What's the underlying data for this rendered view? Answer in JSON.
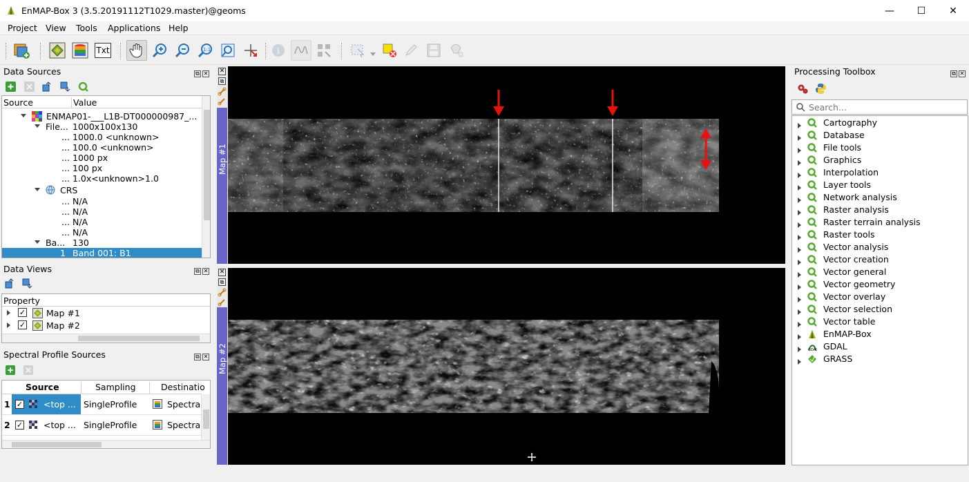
{
  "window": {
    "title": "EnMAP-Box 3 (3.5.20191112T1029.master)@geoms",
    "minimize": "—",
    "maximize": "☐",
    "close": "✕"
  },
  "menu": [
    "Project",
    "View",
    "Tools",
    "Applications",
    "Help"
  ],
  "toolbar": {
    "text_button": "Txt"
  },
  "data_sources": {
    "title": "Data Sources",
    "columns": [
      "Source",
      "Value"
    ],
    "rows": [
      {
        "source": "ENMAP01-___L1B-DT000000987_...",
        "value": ""
      },
      {
        "source": "File...",
        "value": "1000x100x130"
      },
      {
        "source": "...",
        "value": "1000.0 <unknown>"
      },
      {
        "source": "...",
        "value": "100.0 <unknown>"
      },
      {
        "source": "...",
        "value": "1000 px"
      },
      {
        "source": "...",
        "value": "100 px"
      },
      {
        "source": "...",
        "value": "1.0x<unknown>1.0"
      },
      {
        "source": "CRS",
        "value": ""
      },
      {
        "source": "...",
        "value": "N/A"
      },
      {
        "source": "...",
        "value": "N/A"
      },
      {
        "source": "...",
        "value": "N/A"
      },
      {
        "source": "...",
        "value": "N/A"
      },
      {
        "source": "Ba...",
        "value": "130"
      },
      {
        "source": "1",
        "value": "Band 001: B1"
      }
    ]
  },
  "data_views": {
    "title": "Data Views",
    "column": "Property",
    "items": [
      "Map #1",
      "Map #2"
    ]
  },
  "spectral": {
    "title": "Spectral Profile Sources",
    "columns": [
      "Source",
      "Sampling",
      "Destinatio"
    ],
    "rows": [
      {
        "num": "1",
        "source": "<top ...",
        "sampling": "SingleProfile",
        "destination": "Spectra"
      },
      {
        "num": "2",
        "source": "<top ...",
        "sampling": "SingleProfile",
        "destination": "Spectra"
      }
    ]
  },
  "maps": {
    "map1": "Map #1",
    "map2": "Map #2"
  },
  "processing": {
    "title": "Processing Toolbox",
    "search_placeholder": "Search...",
    "items": [
      {
        "label": "Cartography",
        "icon": "qgis-icon"
      },
      {
        "label": "Database",
        "icon": "qgis-icon"
      },
      {
        "label": "File tools",
        "icon": "qgis-icon"
      },
      {
        "label": "Graphics",
        "icon": "qgis-icon"
      },
      {
        "label": "Interpolation",
        "icon": "qgis-icon"
      },
      {
        "label": "Layer tools",
        "icon": "qgis-icon"
      },
      {
        "label": "Network analysis",
        "icon": "qgis-icon"
      },
      {
        "label": "Raster analysis",
        "icon": "qgis-icon"
      },
      {
        "label": "Raster terrain analysis",
        "icon": "qgis-icon"
      },
      {
        "label": "Raster tools",
        "icon": "qgis-icon"
      },
      {
        "label": "Vector analysis",
        "icon": "qgis-icon"
      },
      {
        "label": "Vector creation",
        "icon": "qgis-icon"
      },
      {
        "label": "Vector general",
        "icon": "qgis-icon"
      },
      {
        "label": "Vector geometry",
        "icon": "qgis-icon"
      },
      {
        "label": "Vector overlay",
        "icon": "qgis-icon"
      },
      {
        "label": "Vector selection",
        "icon": "qgis-icon"
      },
      {
        "label": "Vector table",
        "icon": "qgis-icon"
      },
      {
        "label": "EnMAP-Box",
        "icon": "enmap-icon"
      },
      {
        "label": "GDAL",
        "icon": "gdal-icon"
      },
      {
        "label": "GRASS",
        "icon": "grass-icon"
      }
    ]
  },
  "colors": {
    "selection": "#308cc6",
    "map_tab": "#6a63c8",
    "annotation_arrow": "#e8120c"
  }
}
